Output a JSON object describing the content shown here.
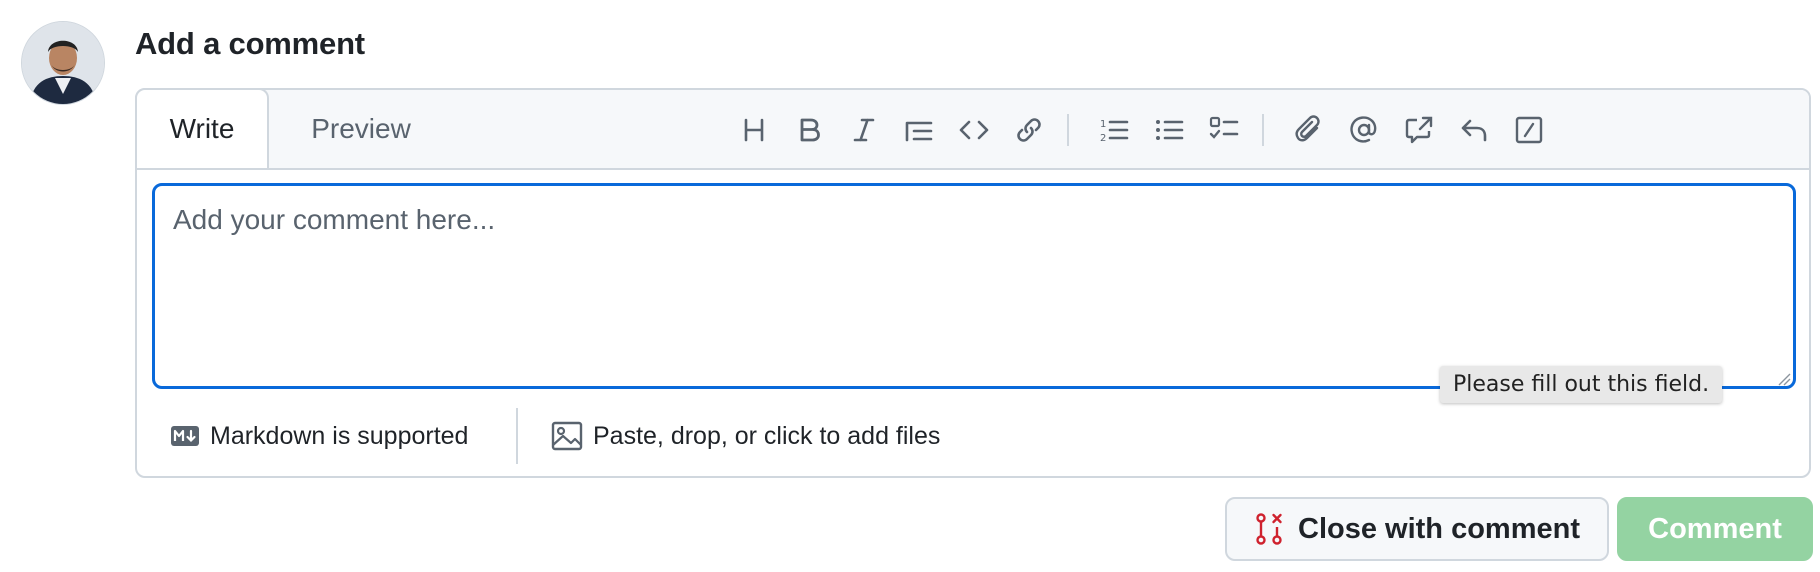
{
  "heading": "Add a comment",
  "tabs": {
    "write": "Write",
    "preview": "Preview",
    "active": "Write"
  },
  "toolbar": {
    "icons": [
      "heading-icon",
      "bold-icon",
      "italic-icon",
      "quote-icon",
      "code-icon",
      "link-icon",
      "numbered-list-icon",
      "unordered-list-icon",
      "task-list-icon",
      "attach-icon",
      "mention-icon",
      "reference-icon",
      "reply-icon",
      "slash-commands-icon"
    ]
  },
  "editor": {
    "placeholder": "Add your comment here...",
    "value": "",
    "validation_message": "Please fill out this field."
  },
  "footer": {
    "markdown_label": "Markdown is supported",
    "files_label": "Paste, drop, or click to add files"
  },
  "actions": {
    "close_with_comment": "Close with comment",
    "comment": "Comment"
  },
  "colors": {
    "accent_focus": "#0969da",
    "comment_disabled": "#94d3a2",
    "close_icon": "#cf222e"
  }
}
